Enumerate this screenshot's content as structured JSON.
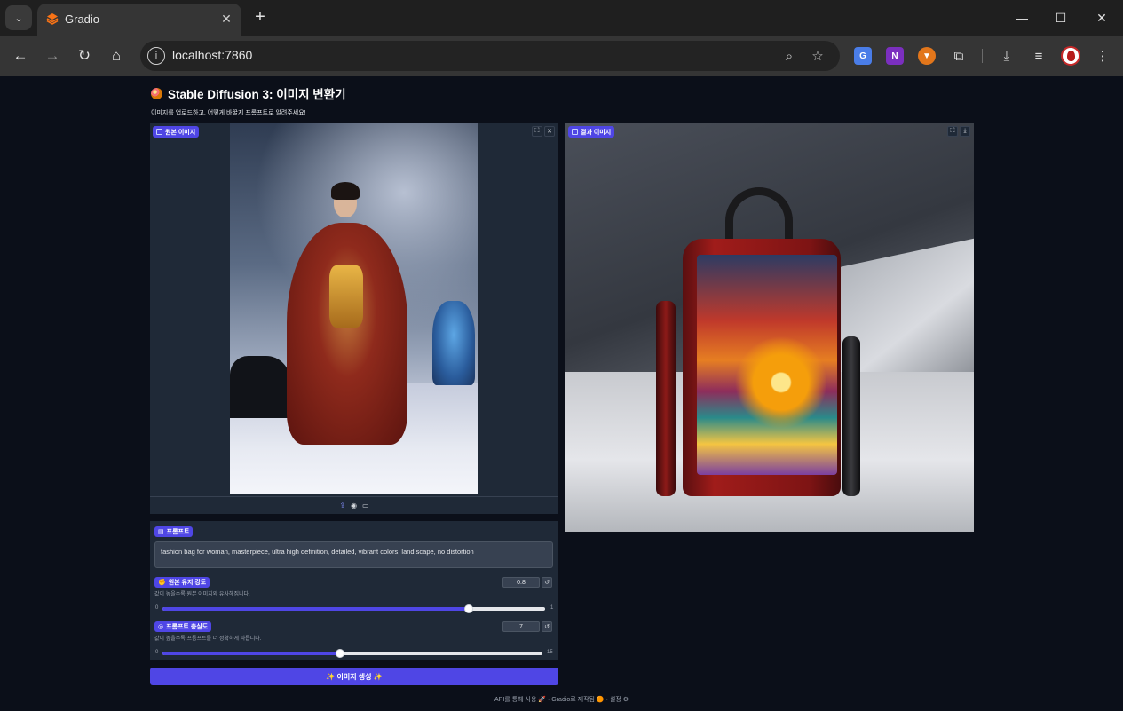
{
  "browser": {
    "tab_title": "Gradio",
    "tab_close": "✕",
    "new_tab": "+",
    "url": "localhost:7860",
    "window_controls": {
      "minimize": "—",
      "maximize": "☐",
      "close": "✕"
    },
    "icons": [
      "tab-search-icon",
      "back-icon",
      "forward-icon",
      "reload-icon",
      "home-icon",
      "site-info-icon",
      "zoom-icon",
      "bookmark-star-icon",
      "translate-extension-icon",
      "onenote-extension-icon",
      "metamask-extension-icon",
      "extensions-puzzle-icon",
      "downloads-icon",
      "reading-list-icon",
      "profile-avatar",
      "menu-icon"
    ]
  },
  "app": {
    "title": "Stable Diffusion 3: 이미지 변환기",
    "subtitle": "이미지를 업로드하고, 어떻게 바꿀지 프롬프트로 알려주세요!",
    "source_image": {
      "label": "원본 이미지",
      "toolbar_icons": [
        "upload-icon",
        "webcam-icon",
        "clipboard-icon"
      ]
    },
    "result_image": {
      "label": "결과 이미지"
    },
    "prompt": {
      "label": "프롬프트",
      "value": "fashion bag for woman, masterpiece, ultra high definition, detailed, vibrant colors, land scape, no distortion"
    },
    "strength": {
      "label": "원본 유지 강도",
      "hint": "값이 높을수록 원본 이미지와 유사해집니다.",
      "value": "0.8",
      "min": "0",
      "max": "1",
      "fraction": 0.8
    },
    "guidance": {
      "label": "프롬프트 충실도",
      "hint": "값이 높을수록 프롬프트를 더 정확하게 따릅니다.",
      "value": "7",
      "min": "0",
      "max": "15",
      "fraction": 0.4667
    },
    "generate_button": "✨ 이미지 생성 ✨",
    "footer": "API를 통해 사용 🚀 · Gradio로 제작됨 🟠 · 설정 ⚙"
  },
  "colors": {
    "accent": "#4f46e5",
    "background": "#0b0f19",
    "panel": "#1f2937"
  }
}
